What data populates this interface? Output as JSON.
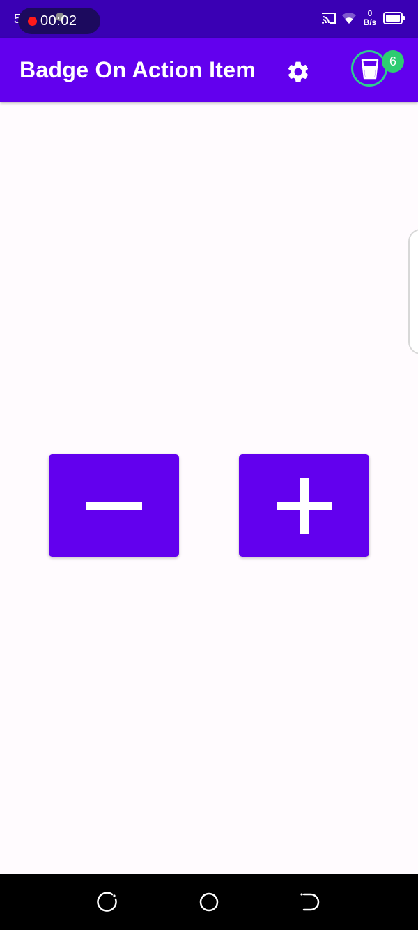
{
  "status_bar": {
    "time": "5:24",
    "recording_timer": "00:02",
    "net_speed_value": "0",
    "net_speed_unit": "B/s",
    "icons": [
      "cast-icon",
      "wifi-icon",
      "battery-icon"
    ]
  },
  "app_bar": {
    "title": "Badge On Action Item",
    "settings_icon": "gear-icon",
    "cart_icon": "glass-icon",
    "badge_count": "6",
    "color": "#6200ee"
  },
  "main": {
    "decrement_icon": "minus-icon",
    "increment_icon": "plus-icon"
  },
  "nav_bar": {
    "buttons": [
      "recents-icon",
      "home-icon",
      "back-icon"
    ]
  },
  "colors": {
    "primary": "#6200ee",
    "primary_dark": "#3a00b4",
    "badge": "#2ecc71",
    "background": "#fffbfe"
  }
}
